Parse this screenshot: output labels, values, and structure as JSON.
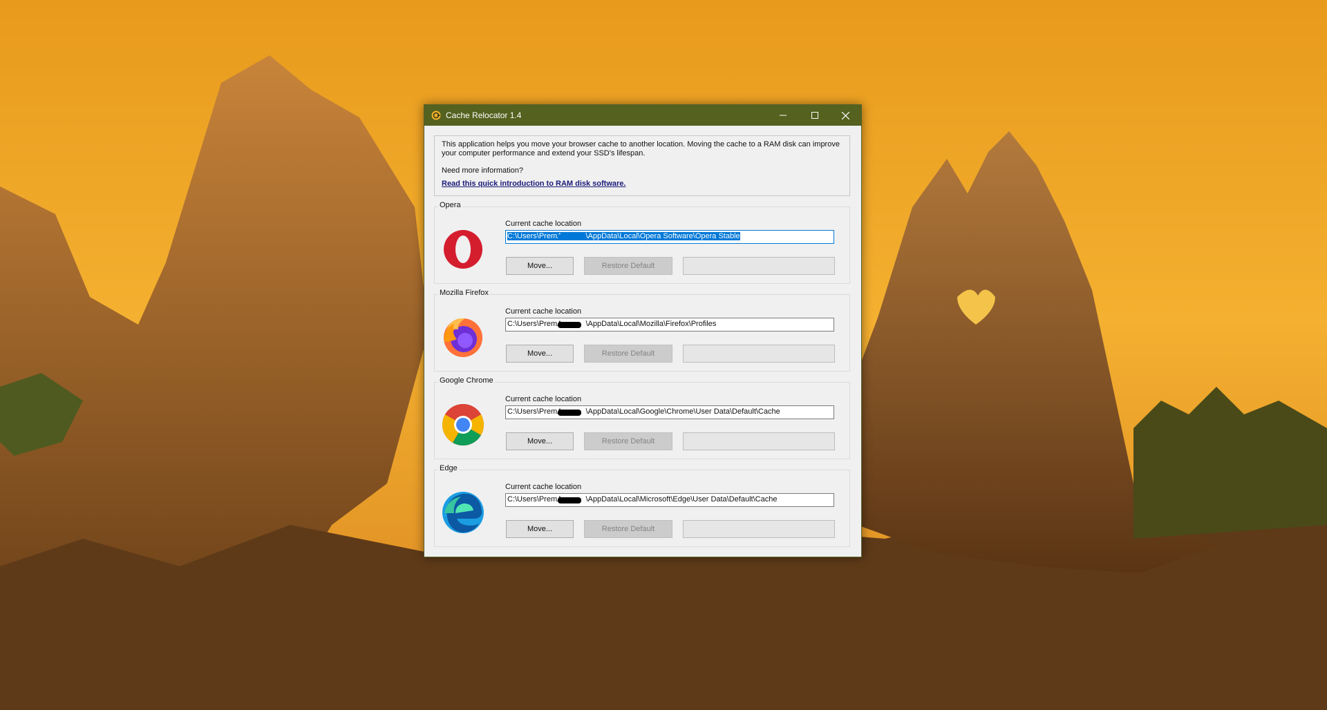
{
  "window": {
    "title": "Cache Relocator 1.4",
    "controls": {
      "minimize": "minimize",
      "maximize": "maximize",
      "close": "close"
    }
  },
  "info": {
    "description": "This application helps you move your browser cache to another location. Moving the cache to a RAM disk can improve your computer performance and extend your SSD's lifespan.",
    "question": "Need more information?",
    "link": "Read this quick introduction to RAM disk software."
  },
  "browsers": [
    {
      "name": "Opera",
      "cache_label": "Current cache location",
      "path_prefix": "C:\\Users\\PremA",
      "path_suffix": "\\AppData\\Local\\Opera Software\\Opera Stable",
      "move_label": "Move...",
      "restore_label": "Restore Default",
      "icon": "opera-icon",
      "selected": true
    },
    {
      "name": "Mozilla Firefox",
      "cache_label": "Current cache location",
      "path_prefix": "C:\\Users\\PremA",
      "path_suffix": "\\AppData\\Local\\Mozilla\\Firefox\\Profiles",
      "move_label": "Move...",
      "restore_label": "Restore Default",
      "icon": "firefox-icon",
      "selected": false
    },
    {
      "name": "Google Chrome",
      "cache_label": "Current cache location",
      "path_prefix": "C:\\Users\\PremA",
      "path_suffix": "\\AppData\\Local\\Google\\Chrome\\User Data\\Default\\Cache",
      "move_label": "Move...",
      "restore_label": "Restore Default",
      "icon": "chrome-icon",
      "selected": false
    },
    {
      "name": "Edge",
      "cache_label": "Current cache location",
      "path_prefix": "C:\\Users\\PremA",
      "path_suffix": "\\AppData\\Local\\Microsoft\\Edge\\User Data\\Default\\Cache",
      "move_label": "Move...",
      "restore_label": "Restore Default",
      "icon": "edge-icon",
      "selected": false
    }
  ],
  "colors": {
    "titlebar": "#54611f",
    "selection": "#0078d7",
    "link": "#1a1a7a"
  }
}
